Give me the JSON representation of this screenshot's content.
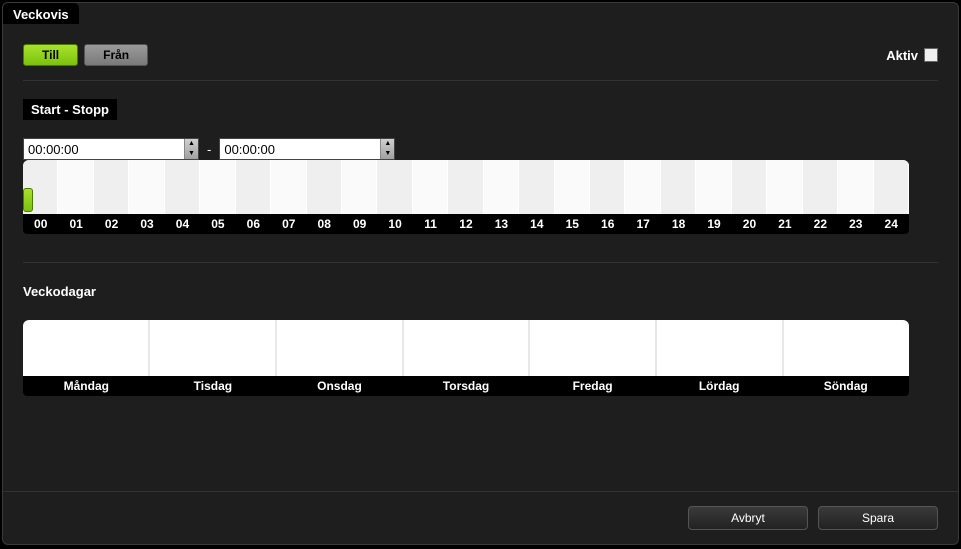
{
  "title": "Veckovis",
  "toggle": {
    "on_label": "Till",
    "off_label": "Från",
    "active": "on"
  },
  "active_label": "Aktiv",
  "active_checked": false,
  "section_startstop": "Start - Stopp",
  "start_time": "00:00:00",
  "end_time": "00:00:00",
  "separator": "-",
  "timeline_hours": [
    "00",
    "01",
    "02",
    "03",
    "04",
    "05",
    "06",
    "07",
    "08",
    "09",
    "10",
    "11",
    "12",
    "13",
    "14",
    "15",
    "16",
    "17",
    "18",
    "19",
    "20",
    "21",
    "22",
    "23",
    "24"
  ],
  "section_weekdays": "Veckodagar",
  "weekdays": [
    "Måndag",
    "Tisdag",
    "Onsdag",
    "Torsdag",
    "Fredag",
    "Lördag",
    "Söndag"
  ],
  "footer": {
    "cancel": "Avbryt",
    "save": "Spara"
  }
}
